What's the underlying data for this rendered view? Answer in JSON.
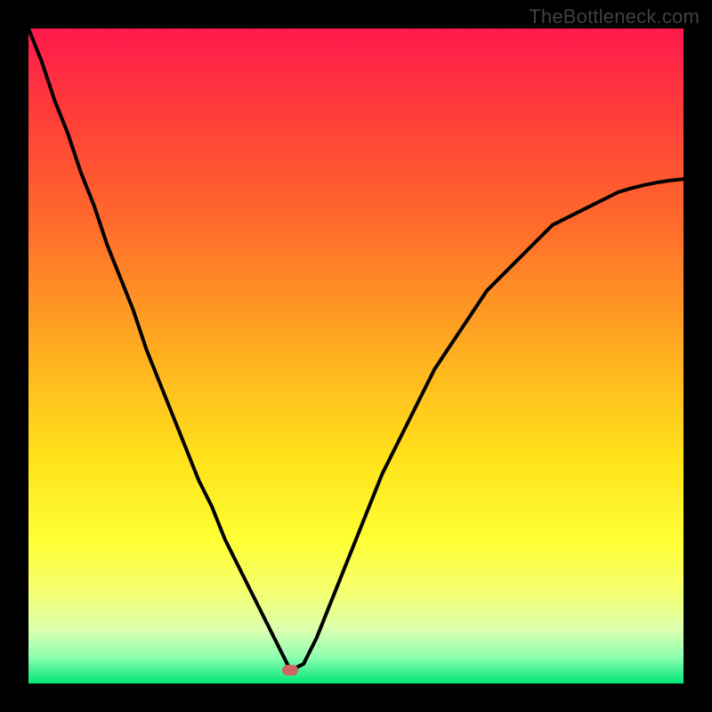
{
  "watermark": "TheBottleneck.com",
  "colors": {
    "background": "#000000",
    "marker": "#cc6666",
    "gradient_stops": [
      {
        "offset": 0.0,
        "color": "#ff1a4d"
      },
      {
        "offset": 0.12,
        "color": "#ff3a3a"
      },
      {
        "offset": 0.3,
        "color": "#ff6b2b"
      },
      {
        "offset": 0.5,
        "color": "#ffb020"
      },
      {
        "offset": 0.65,
        "color": "#ffe01a"
      },
      {
        "offset": 0.78,
        "color": "#ffff33"
      },
      {
        "offset": 0.86,
        "color": "#f5ff70"
      },
      {
        "offset": 0.92,
        "color": "#d9ffb0"
      },
      {
        "offset": 0.96,
        "color": "#8cffb0"
      },
      {
        "offset": 1.0,
        "color": "#00e676"
      }
    ]
  },
  "chart_data": {
    "type": "line",
    "title": "",
    "xlabel": "",
    "ylabel": "",
    "xlim": [
      0,
      100
    ],
    "ylim": [
      0,
      100
    ],
    "x": [
      0,
      2,
      4,
      6,
      8,
      10,
      12,
      14,
      16,
      18,
      20,
      22,
      24,
      26,
      28,
      30,
      32,
      34,
      36,
      37,
      38,
      39,
      40,
      42,
      44,
      46,
      48,
      50,
      52,
      54,
      56,
      58,
      60,
      62,
      64,
      66,
      68,
      70,
      72,
      74,
      76,
      78,
      80,
      82,
      84,
      86,
      88,
      90,
      92,
      94,
      96,
      98,
      100
    ],
    "values": [
      100,
      95,
      89,
      84,
      78,
      73,
      67,
      62,
      57,
      51,
      46,
      41,
      36,
      31,
      27,
      22,
      18,
      14,
      10,
      8,
      6,
      4,
      2,
      3,
      7,
      12,
      17,
      22,
      27,
      32,
      36,
      40,
      44,
      48,
      51,
      54,
      57,
      60,
      62,
      64,
      66,
      68,
      70,
      71,
      72,
      73,
      74,
      75,
      75.6,
      76.1,
      76.5,
      76.8,
      77
    ],
    "marker": {
      "x": 40,
      "y": 2
    },
    "annotations": []
  }
}
